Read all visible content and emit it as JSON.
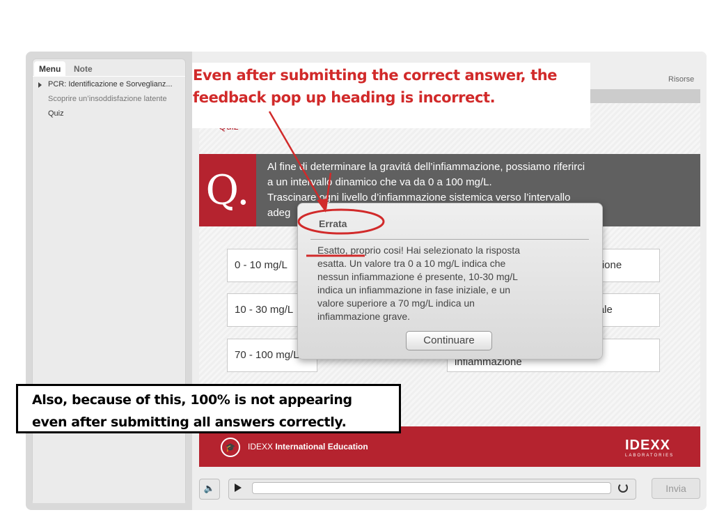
{
  "sidebar": {
    "tabs": [
      "Menu",
      "Note"
    ],
    "items": [
      {
        "label": "PCR: Identificazione e Sorveglianz..."
      },
      {
        "label": "Scoprire un’insoddisfazione latente"
      },
      {
        "label": "Quiz"
      }
    ]
  },
  "header": {
    "resources_link": "Risorse"
  },
  "slide": {
    "title_fragment": "Quiz",
    "q_mark": "Q.",
    "question_lines": [
      "Al fine di determinare la gravitá dell’infiammazione, possiamo riferirci",
      "a un intervallo dinamico che va da 0 a 100 mg/L.",
      "Trascinare ogni livello d’infiammazione sistemica verso l’intervallo",
      "adeg"
    ],
    "drag_items": [
      "0 - 10 mg/L",
      "10 - 30 mg/L",
      "70 - 100 mg/L"
    ],
    "drop_targets": [
      "azione",
      "ziale",
      "infiammazione"
    ]
  },
  "popup": {
    "title": "Errata",
    "body_lines": [
      "Esatto, proprio cosi! Hai selezionato la risposta",
      "esatta. Un valore tra 0 a 10 mg/L indica che",
      "nessun infiammazione é presente, 10-30 mg/L",
      "indica un infiammazione in fase iniziale, e un",
      "valore superiore a 70 mg/L indica un",
      "infiammazione grave."
    ],
    "button_label": "Continuare"
  },
  "footer": {
    "brand_prefix": "IDEXX",
    "brand_suffix": "International Education",
    "logo_text": "IDEXX",
    "logo_subtext": "LABORATORIES"
  },
  "player": {
    "submit_label": "Invia",
    "progress_fraction": 0.0
  },
  "annotations": {
    "top_note_lines": [
      "Even after submitting the correct answer, the",
      "feedback pop up heading is incorrect."
    ],
    "bottom_note_lines": [
      "Also, because of this, 100% is not appearing",
      "even after submitting all answers correctly."
    ]
  },
  "colors": {
    "brand_red": "#b5232f",
    "annotation_red": "#d12a2a",
    "question_bg": "#606060"
  }
}
